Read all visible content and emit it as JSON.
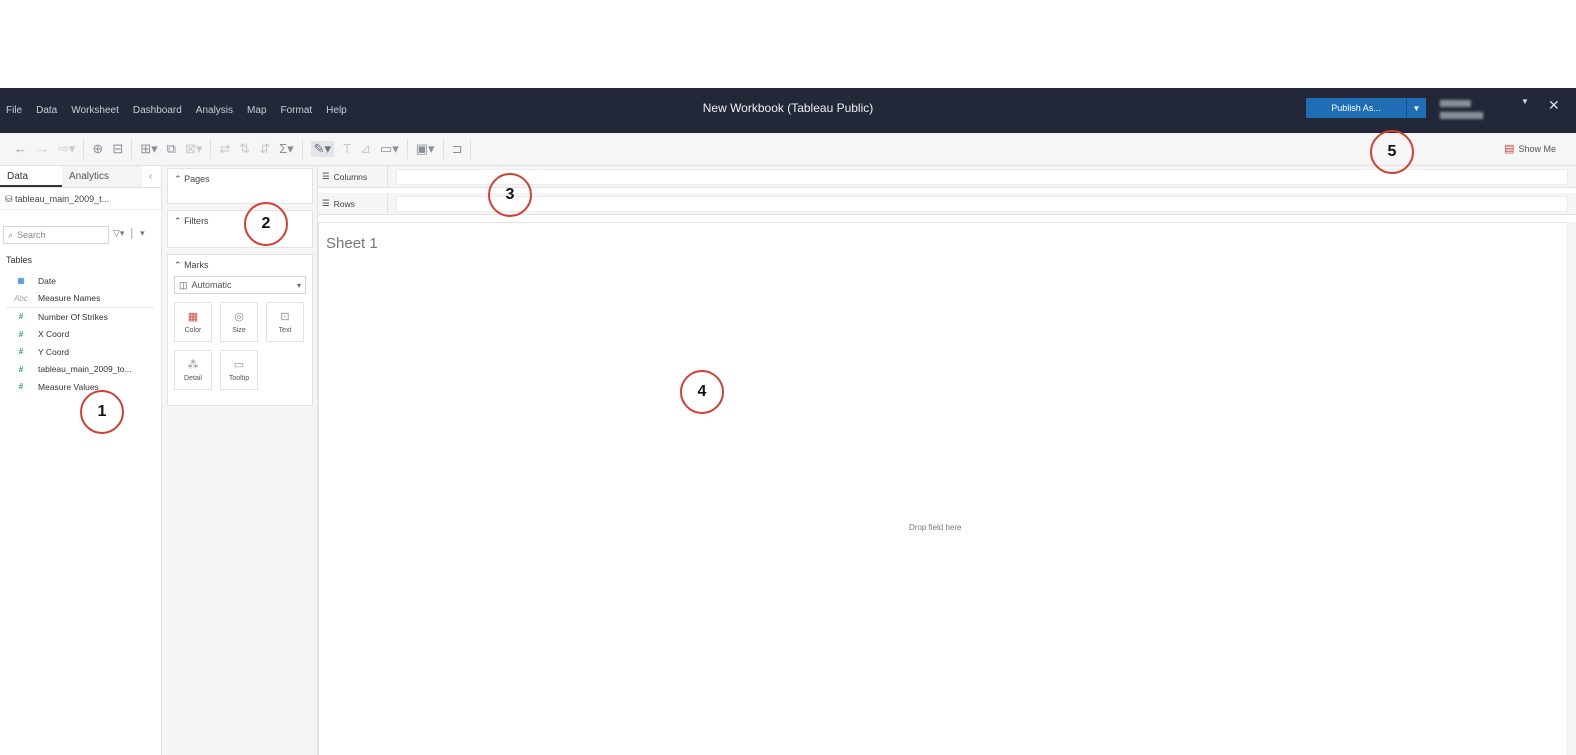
{
  "app": {
    "menu": [
      "File",
      "Data",
      "Worksheet",
      "Dashboard",
      "Analysis",
      "Map",
      "Format",
      "Help"
    ],
    "window_title": "New Workbook (Tableau Public)",
    "publish_label": "Publish As...",
    "close_glyph": "✕"
  },
  "toolbar": {
    "show_me": "Show Me"
  },
  "data_pane": {
    "tabs": [
      "Data",
      "Analytics"
    ],
    "collapse_glyph": "‹",
    "datasource": "tableau_main_2009_t...",
    "search_placeholder": "Search",
    "tables_heading": "Tables",
    "fields": [
      {
        "type": "date",
        "glyph": "📅",
        "label": "Date"
      },
      {
        "type": "abc",
        "glyph": "Abc",
        "label": "Measure Names"
      },
      {
        "type": "measure",
        "glyph": "#",
        "label": "Number Of Strikes"
      },
      {
        "type": "measure",
        "glyph": "#",
        "label": "X Coord"
      },
      {
        "type": "measure",
        "glyph": "#",
        "label": "Y Coord"
      },
      {
        "type": "measure",
        "glyph": "#",
        "label": "tableau_main_2009_to..."
      },
      {
        "type": "measure",
        "glyph": "#",
        "label": "Measure Values"
      }
    ]
  },
  "shelves": {
    "pages": "Pages",
    "filters": "Filters",
    "marks": "Marks",
    "mark_type": "Automatic",
    "mark_buttons": [
      {
        "label": "Color",
        "icon": "color-icon"
      },
      {
        "label": "Size",
        "icon": "size-icon"
      },
      {
        "label": "Text",
        "icon": "text-icon"
      },
      {
        "label": "Detail",
        "icon": "detail-icon"
      },
      {
        "label": "Tooltip",
        "icon": "tooltip-icon"
      }
    ],
    "columns": "Columns",
    "rows": "Rows"
  },
  "canvas": {
    "sheet_title": "Sheet 1",
    "drop_hint": "Drop field here"
  },
  "callouts": [
    "1",
    "2",
    "3",
    "4",
    "5"
  ],
  "colors": {
    "titlebar": "#232838",
    "publish": "#1f6db5",
    "callout_ring": "#d23f2f"
  }
}
